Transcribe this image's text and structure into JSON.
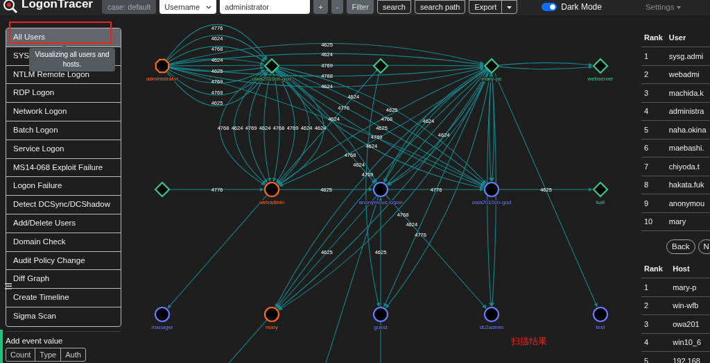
{
  "navbar": {
    "logo_text": "LogonTracer",
    "case_badge": "case: default",
    "search_type": "Username",
    "search_value": "administrator",
    "buttons": [
      {
        "label": "+",
        "kind": "filled"
      },
      {
        "label": "-",
        "kind": "filled"
      },
      {
        "label": "Filter",
        "kind": "filled"
      },
      {
        "label": "search",
        "kind": "outline"
      },
      {
        "label": "search path",
        "kind": "outline"
      }
    ],
    "export": {
      "label": "Export"
    },
    "dark_mode": {
      "label": "Dark Mode",
      "on": true
    },
    "settings": {
      "label": "Settings"
    }
  },
  "sidebar": {
    "items": [
      {
        "label": "All Users",
        "selected": true,
        "highlighted": true
      },
      {
        "label": "SYS",
        "selected": false,
        "highlighted": false
      },
      {
        "label": "NTLM Remote Logon",
        "selected": false,
        "highlighted": false
      },
      {
        "label": "RDP Logon",
        "selected": false,
        "highlighted": false
      },
      {
        "label": "Network Logon",
        "selected": false,
        "highlighted": false
      },
      {
        "label": "Batch Logon",
        "selected": false,
        "highlighted": false
      },
      {
        "label": "Service Logon",
        "selected": false,
        "highlighted": false
      },
      {
        "label": "MS14-068 Exploit Failure",
        "selected": false,
        "highlighted": false
      },
      {
        "label": "Logon Failure",
        "selected": false,
        "highlighted": false
      },
      {
        "label": "Detect DCSync/DCShadow",
        "selected": false,
        "highlighted": false
      },
      {
        "label": "Add/Delete Users",
        "selected": false,
        "highlighted": false
      },
      {
        "label": "Domain Check",
        "selected": false,
        "highlighted": false
      },
      {
        "label": "Audit Policy Change",
        "selected": false,
        "highlighted": false
      },
      {
        "label": "Diff Graph",
        "selected": false,
        "highlighted": false
      },
      {
        "label": "Create Timeline",
        "selected": false,
        "highlighted": false
      },
      {
        "label": "Sigma Scan",
        "selected": false,
        "highlighted": false
      }
    ],
    "tooltip": "Visualizing all users and hosts.",
    "event_value": {
      "label": "Add event value",
      "options": [
        "Count",
        "Type",
        "Auth"
      ]
    }
  },
  "graph": {
    "nodes": [
      {
        "label": "administrator",
        "kind": "admin",
        "color": "#ff6a22"
      },
      {
        "label": "owa2010cn-god",
        "kind": "host",
        "color": "#3cc48a"
      },
      {
        "kind": "host",
        "color": "#3cc48a"
      },
      {
        "label": "mary-pc",
        "kind": "host",
        "color": "#3cc48a"
      },
      {
        "label": "webserver",
        "kind": "host",
        "color": "#3cc48a"
      },
      {
        "kind": "host",
        "color": "#3cc48a"
      },
      {
        "label": "webadmin",
        "kind": "user",
        "color": "#ff6a22"
      },
      {
        "label": "anonymous logon",
        "kind": "user",
        "color": "#6a7dff"
      },
      {
        "label": "owa2010cn-god",
        "kind": "user",
        "color": "#6a7dff"
      },
      {
        "label": "kali",
        "kind": "host",
        "color": "#3cc48a"
      },
      {
        "label": "manager",
        "kind": "user",
        "color": "#6a7dff"
      },
      {
        "label": "mary",
        "kind": "user",
        "color": "#ff6a22"
      },
      {
        "label": "guest",
        "kind": "user",
        "color": "#6a7dff"
      },
      {
        "label": "dc2admin",
        "kind": "user",
        "color": "#6a7dff"
      },
      {
        "label": "test",
        "kind": "user",
        "color": "#6a7dff"
      }
    ],
    "edge_labels": [
      "4776",
      "4624",
      "4768",
      "4624",
      "4625",
      "4769",
      "4769",
      "4625",
      "4625",
      "4624",
      "4769",
      "4768",
      "4624",
      "4768",
      "4624",
      "4769",
      "4624",
      "4768",
      "4769",
      "4624",
      "4624",
      "4776",
      "4625",
      "4776",
      "4625",
      "4625",
      "4768",
      "4625",
      "4769",
      "4624",
      "4624",
      "4624",
      "4624",
      "4776",
      "4624",
      "4768",
      "4624",
      "4769",
      "4768",
      "4624",
      "4776",
      "4625",
      "4625"
    ]
  },
  "annotation": "扫描结果",
  "user_ranking": {
    "columns": [
      "Rank",
      "User"
    ],
    "rows": [
      [
        "1",
        "sysg.admi"
      ],
      [
        "2",
        "webadmi"
      ],
      [
        "3",
        "machida.k"
      ],
      [
        "4",
        "administra"
      ],
      [
        "5",
        "naha.okina"
      ],
      [
        "6",
        "maebashi."
      ],
      [
        "7",
        "chiyoda.t"
      ],
      [
        "8",
        "hakata.fuk"
      ],
      [
        "9",
        "anonymou"
      ],
      [
        "10",
        "mary"
      ]
    ]
  },
  "pager": [
    "Back",
    "N"
  ],
  "host_ranking": {
    "columns": [
      "Rank",
      "Host"
    ],
    "rows": [
      [
        "1",
        "mary-p"
      ],
      [
        "2",
        "win-wfb"
      ],
      [
        "3",
        "owa201"
      ],
      [
        "4",
        "win10_6"
      ],
      [
        "5",
        "192.168"
      ]
    ]
  }
}
